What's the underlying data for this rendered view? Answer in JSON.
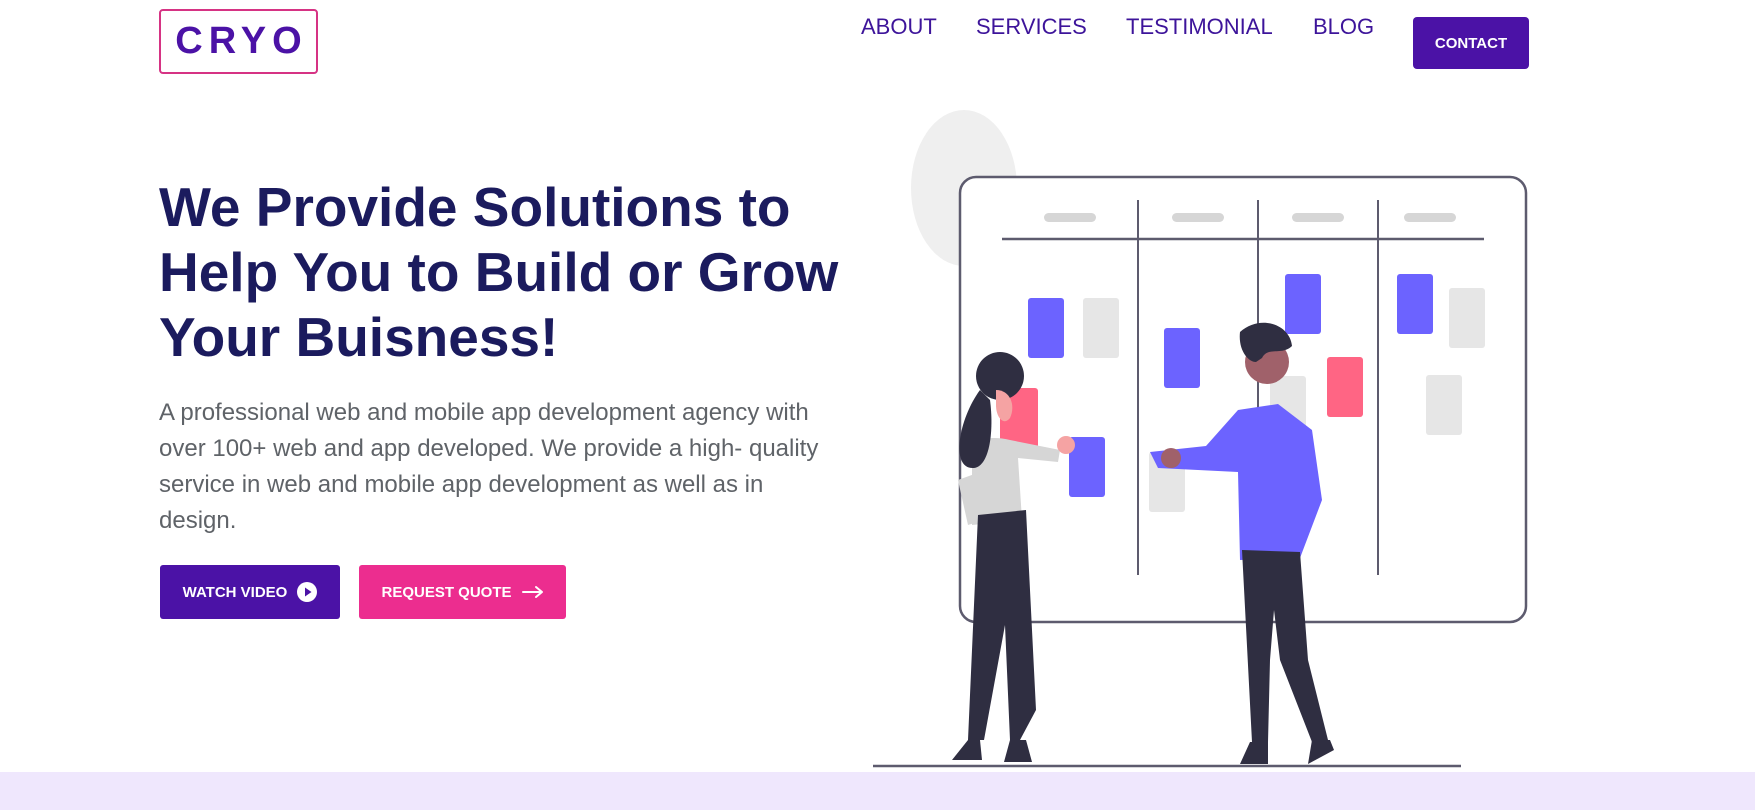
{
  "brand": {
    "logo_text": "CRYO"
  },
  "nav": {
    "items": [
      {
        "label": "ABOUT"
      },
      {
        "label": "SERVICES"
      },
      {
        "label": "TESTIMONIAL"
      },
      {
        "label": "BLOG"
      }
    ],
    "contact_label": "CONTACT"
  },
  "hero": {
    "title": "We Provide Solutions to Help You to Build or Grow Your Buisness!",
    "description": "A professional web and mobile app development agency with over 100+ web and app developed. We provide a high- quality service in web and mobile app development as well as in design.",
    "watch_label": "WATCH VIDEO",
    "watch_icon": "play-circle-icon",
    "quote_label": "REQUEST QUOTE",
    "quote_icon": "arrow-right-icon"
  },
  "colors": {
    "brand_purple": "#4b12a6",
    "accent_pink": "#ec2d8f",
    "heading_navy": "#1b1b5e",
    "card_blue": "#6c63ff",
    "card_pink": "#ff6584",
    "footer_band": "#efe7fd"
  }
}
